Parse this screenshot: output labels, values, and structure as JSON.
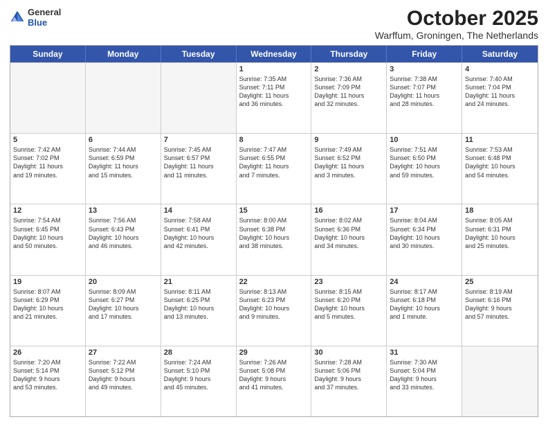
{
  "header": {
    "logo_general": "General",
    "logo_blue": "Blue",
    "month": "October 2025",
    "location": "Warffum, Groningen, The Netherlands"
  },
  "days_of_week": [
    "Sunday",
    "Monday",
    "Tuesday",
    "Wednesday",
    "Thursday",
    "Friday",
    "Saturday"
  ],
  "weeks": [
    [
      {
        "day": "",
        "text": "",
        "empty": true
      },
      {
        "day": "",
        "text": "",
        "empty": true
      },
      {
        "day": "",
        "text": "",
        "empty": true
      },
      {
        "day": "1",
        "text": "Sunrise: 7:35 AM\nSunset: 7:11 PM\nDaylight: 11 hours\nand 36 minutes."
      },
      {
        "day": "2",
        "text": "Sunrise: 7:36 AM\nSunset: 7:09 PM\nDaylight: 11 hours\nand 32 minutes."
      },
      {
        "day": "3",
        "text": "Sunrise: 7:38 AM\nSunset: 7:07 PM\nDaylight: 11 hours\nand 28 minutes."
      },
      {
        "day": "4",
        "text": "Sunrise: 7:40 AM\nSunset: 7:04 PM\nDaylight: 11 hours\nand 24 minutes."
      }
    ],
    [
      {
        "day": "5",
        "text": "Sunrise: 7:42 AM\nSunset: 7:02 PM\nDaylight: 11 hours\nand 19 minutes."
      },
      {
        "day": "6",
        "text": "Sunrise: 7:44 AM\nSunset: 6:59 PM\nDaylight: 11 hours\nand 15 minutes."
      },
      {
        "day": "7",
        "text": "Sunrise: 7:45 AM\nSunset: 6:57 PM\nDaylight: 11 hours\nand 11 minutes."
      },
      {
        "day": "8",
        "text": "Sunrise: 7:47 AM\nSunset: 6:55 PM\nDaylight: 11 hours\nand 7 minutes."
      },
      {
        "day": "9",
        "text": "Sunrise: 7:49 AM\nSunset: 6:52 PM\nDaylight: 11 hours\nand 3 minutes."
      },
      {
        "day": "10",
        "text": "Sunrise: 7:51 AM\nSunset: 6:50 PM\nDaylight: 10 hours\nand 59 minutes."
      },
      {
        "day": "11",
        "text": "Sunrise: 7:53 AM\nSunset: 6:48 PM\nDaylight: 10 hours\nand 54 minutes."
      }
    ],
    [
      {
        "day": "12",
        "text": "Sunrise: 7:54 AM\nSunset: 6:45 PM\nDaylight: 10 hours\nand 50 minutes."
      },
      {
        "day": "13",
        "text": "Sunrise: 7:56 AM\nSunset: 6:43 PM\nDaylight: 10 hours\nand 46 minutes."
      },
      {
        "day": "14",
        "text": "Sunrise: 7:58 AM\nSunset: 6:41 PM\nDaylight: 10 hours\nand 42 minutes."
      },
      {
        "day": "15",
        "text": "Sunrise: 8:00 AM\nSunset: 6:38 PM\nDaylight: 10 hours\nand 38 minutes."
      },
      {
        "day": "16",
        "text": "Sunrise: 8:02 AM\nSunset: 6:36 PM\nDaylight: 10 hours\nand 34 minutes."
      },
      {
        "day": "17",
        "text": "Sunrise: 8:04 AM\nSunset: 6:34 PM\nDaylight: 10 hours\nand 30 minutes."
      },
      {
        "day": "18",
        "text": "Sunrise: 8:05 AM\nSunset: 6:31 PM\nDaylight: 10 hours\nand 25 minutes."
      }
    ],
    [
      {
        "day": "19",
        "text": "Sunrise: 8:07 AM\nSunset: 6:29 PM\nDaylight: 10 hours\nand 21 minutes."
      },
      {
        "day": "20",
        "text": "Sunrise: 8:09 AM\nSunset: 6:27 PM\nDaylight: 10 hours\nand 17 minutes."
      },
      {
        "day": "21",
        "text": "Sunrise: 8:11 AM\nSunset: 6:25 PM\nDaylight: 10 hours\nand 13 minutes."
      },
      {
        "day": "22",
        "text": "Sunrise: 8:13 AM\nSunset: 6:23 PM\nDaylight: 10 hours\nand 9 minutes."
      },
      {
        "day": "23",
        "text": "Sunrise: 8:15 AM\nSunset: 6:20 PM\nDaylight: 10 hours\nand 5 minutes."
      },
      {
        "day": "24",
        "text": "Sunrise: 8:17 AM\nSunset: 6:18 PM\nDaylight: 10 hours\nand 1 minute."
      },
      {
        "day": "25",
        "text": "Sunrise: 8:19 AM\nSunset: 6:16 PM\nDaylight: 9 hours\nand 57 minutes."
      }
    ],
    [
      {
        "day": "26",
        "text": "Sunrise: 7:20 AM\nSunset: 5:14 PM\nDaylight: 9 hours\nand 53 minutes."
      },
      {
        "day": "27",
        "text": "Sunrise: 7:22 AM\nSunset: 5:12 PM\nDaylight: 9 hours\nand 49 minutes."
      },
      {
        "day": "28",
        "text": "Sunrise: 7:24 AM\nSunset: 5:10 PM\nDaylight: 9 hours\nand 45 minutes."
      },
      {
        "day": "29",
        "text": "Sunrise: 7:26 AM\nSunset: 5:08 PM\nDaylight: 9 hours\nand 41 minutes."
      },
      {
        "day": "30",
        "text": "Sunrise: 7:28 AM\nSunset: 5:06 PM\nDaylight: 9 hours\nand 37 minutes."
      },
      {
        "day": "31",
        "text": "Sunrise: 7:30 AM\nSunset: 5:04 PM\nDaylight: 9 hours\nand 33 minutes."
      },
      {
        "day": "",
        "text": "",
        "empty": true
      }
    ]
  ]
}
